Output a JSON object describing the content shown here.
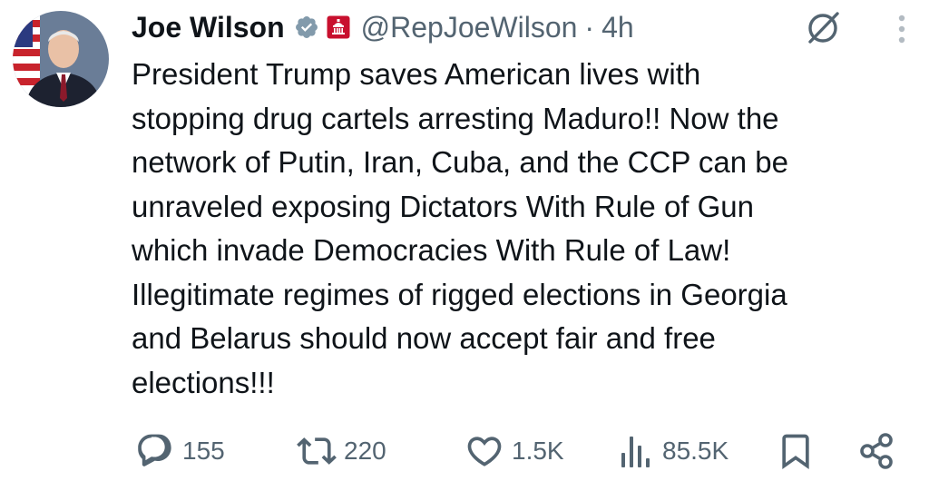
{
  "tweet": {
    "author_name": "Joe Wilson",
    "handle": "@RepJoeWilson",
    "separator": "·",
    "time": "4h",
    "icons": {
      "verified": "verified-badge-icon",
      "affiliation": "capitol-affiliation-icon",
      "grok": "grok-icon",
      "more": "more-options-icon"
    },
    "text_lines": [
      "President Trump saves American lives with",
      "stopping drug cartels arresting Maduro!! Now the",
      "network of Putin, Iran, Cuba, and the CCP can be",
      "unraveled exposing Dictators With Rule of Gun",
      "which invade Democracies With Rule of Law!",
      "Illegitimate regimes of rigged elections in Georgia",
      "and Belarus should now accept fair and free",
      "elections!!!"
    ],
    "actions": {
      "replies": "155",
      "reposts": "220",
      "likes": "1.5K",
      "views": "85.5K"
    },
    "colors": {
      "text": "#0f1419",
      "secondary": "#536471",
      "verified_badge": "#829aab",
      "affiliation_badge": "#c8102e"
    }
  }
}
